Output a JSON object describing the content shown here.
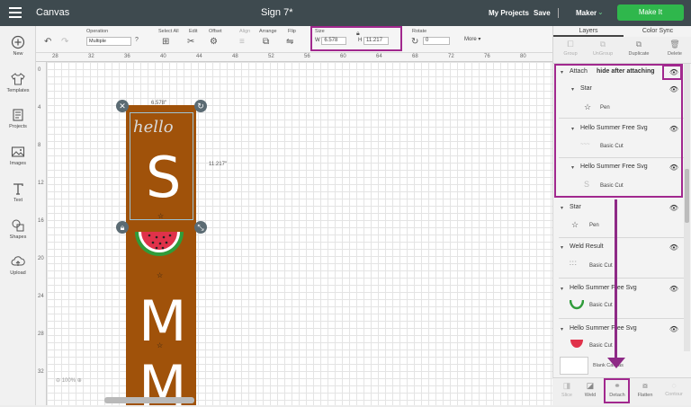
{
  "topbar": {
    "app_title": "Canvas",
    "doc_title": "Sign 7*",
    "my_projects": "My Projects",
    "save": "Save",
    "maker": "Maker",
    "make_it": "Make It"
  },
  "sidebar": {
    "items": [
      {
        "label": "New",
        "icon": "plus-circle-icon"
      },
      {
        "label": "Templates",
        "icon": "shirt-icon"
      },
      {
        "label": "Projects",
        "icon": "projects-icon"
      },
      {
        "label": "Images",
        "icon": "image-icon"
      },
      {
        "label": "Text",
        "icon": "text-icon"
      },
      {
        "label": "Shapes",
        "icon": "shapes-icon"
      },
      {
        "label": "Upload",
        "icon": "upload-cloud-icon"
      }
    ]
  },
  "toolbar": {
    "operation_label": "Operation",
    "operation_value": "Multiple",
    "select_all": "Select All",
    "edit": "Edit",
    "offset": "Offset",
    "align": "Align",
    "arrange": "Arrange",
    "flip": "Flip",
    "size_label": "Size",
    "w_label": "W",
    "w_value": "6.578",
    "h_label": "H",
    "h_value": "11.217",
    "rotate_label": "Rotate",
    "rotate_value": "0",
    "more": "More"
  },
  "rulers": {
    "top": [
      "28",
      "32",
      "36",
      "40",
      "44",
      "48",
      "52",
      "56",
      "60",
      "64",
      "68",
      "72",
      "76",
      "80"
    ],
    "left": [
      "0",
      "4",
      "8",
      "12",
      "16",
      "20",
      "24",
      "28",
      "32"
    ]
  },
  "canvas": {
    "width_label": "6.578\"",
    "height_label": "11.217\"",
    "zoom": "100%",
    "hello_text": "hello",
    "letters": [
      "S",
      "M",
      "M"
    ]
  },
  "panel": {
    "tabs": [
      "Layers",
      "Color Sync"
    ],
    "actions": [
      {
        "label": "Group",
        "enabled": false
      },
      {
        "label": "UnGroup",
        "enabled": false
      },
      {
        "label": "Duplicate",
        "enabled": true
      },
      {
        "label": "Delete",
        "enabled": true
      }
    ],
    "attach_label": "Attach",
    "annotation": "hide after attaching",
    "attach_children": [
      {
        "name": "Star",
        "sub": "Pen"
      },
      {
        "name": "Hello Summer Free Svg",
        "sub": "Basic Cut"
      },
      {
        "name": "Hello Summer Free Svg",
        "sub": "Basic Cut"
      }
    ],
    "layers": [
      {
        "name": "Star",
        "sub": "Pen"
      },
      {
        "name": "Weld Result",
        "sub": "Basic Cut"
      },
      {
        "name": "Hello Summer Free Svg",
        "sub": "Basic Cut"
      },
      {
        "name": "Hello Summer Free Svg",
        "sub": "Basic Cut"
      }
    ],
    "blank_canvas": "Blank Canvas",
    "bottom_actions": [
      {
        "label": "Slice",
        "enabled": false
      },
      {
        "label": "Weld",
        "enabled": true
      },
      {
        "label": "Detach",
        "enabled": true
      },
      {
        "label": "Flatten",
        "enabled": true
      },
      {
        "label": "Contour",
        "enabled": false
      }
    ]
  },
  "colors": {
    "highlight": "#a1288e",
    "make_it_green": "#2fb74c",
    "sign_brown": "#a0520a"
  }
}
